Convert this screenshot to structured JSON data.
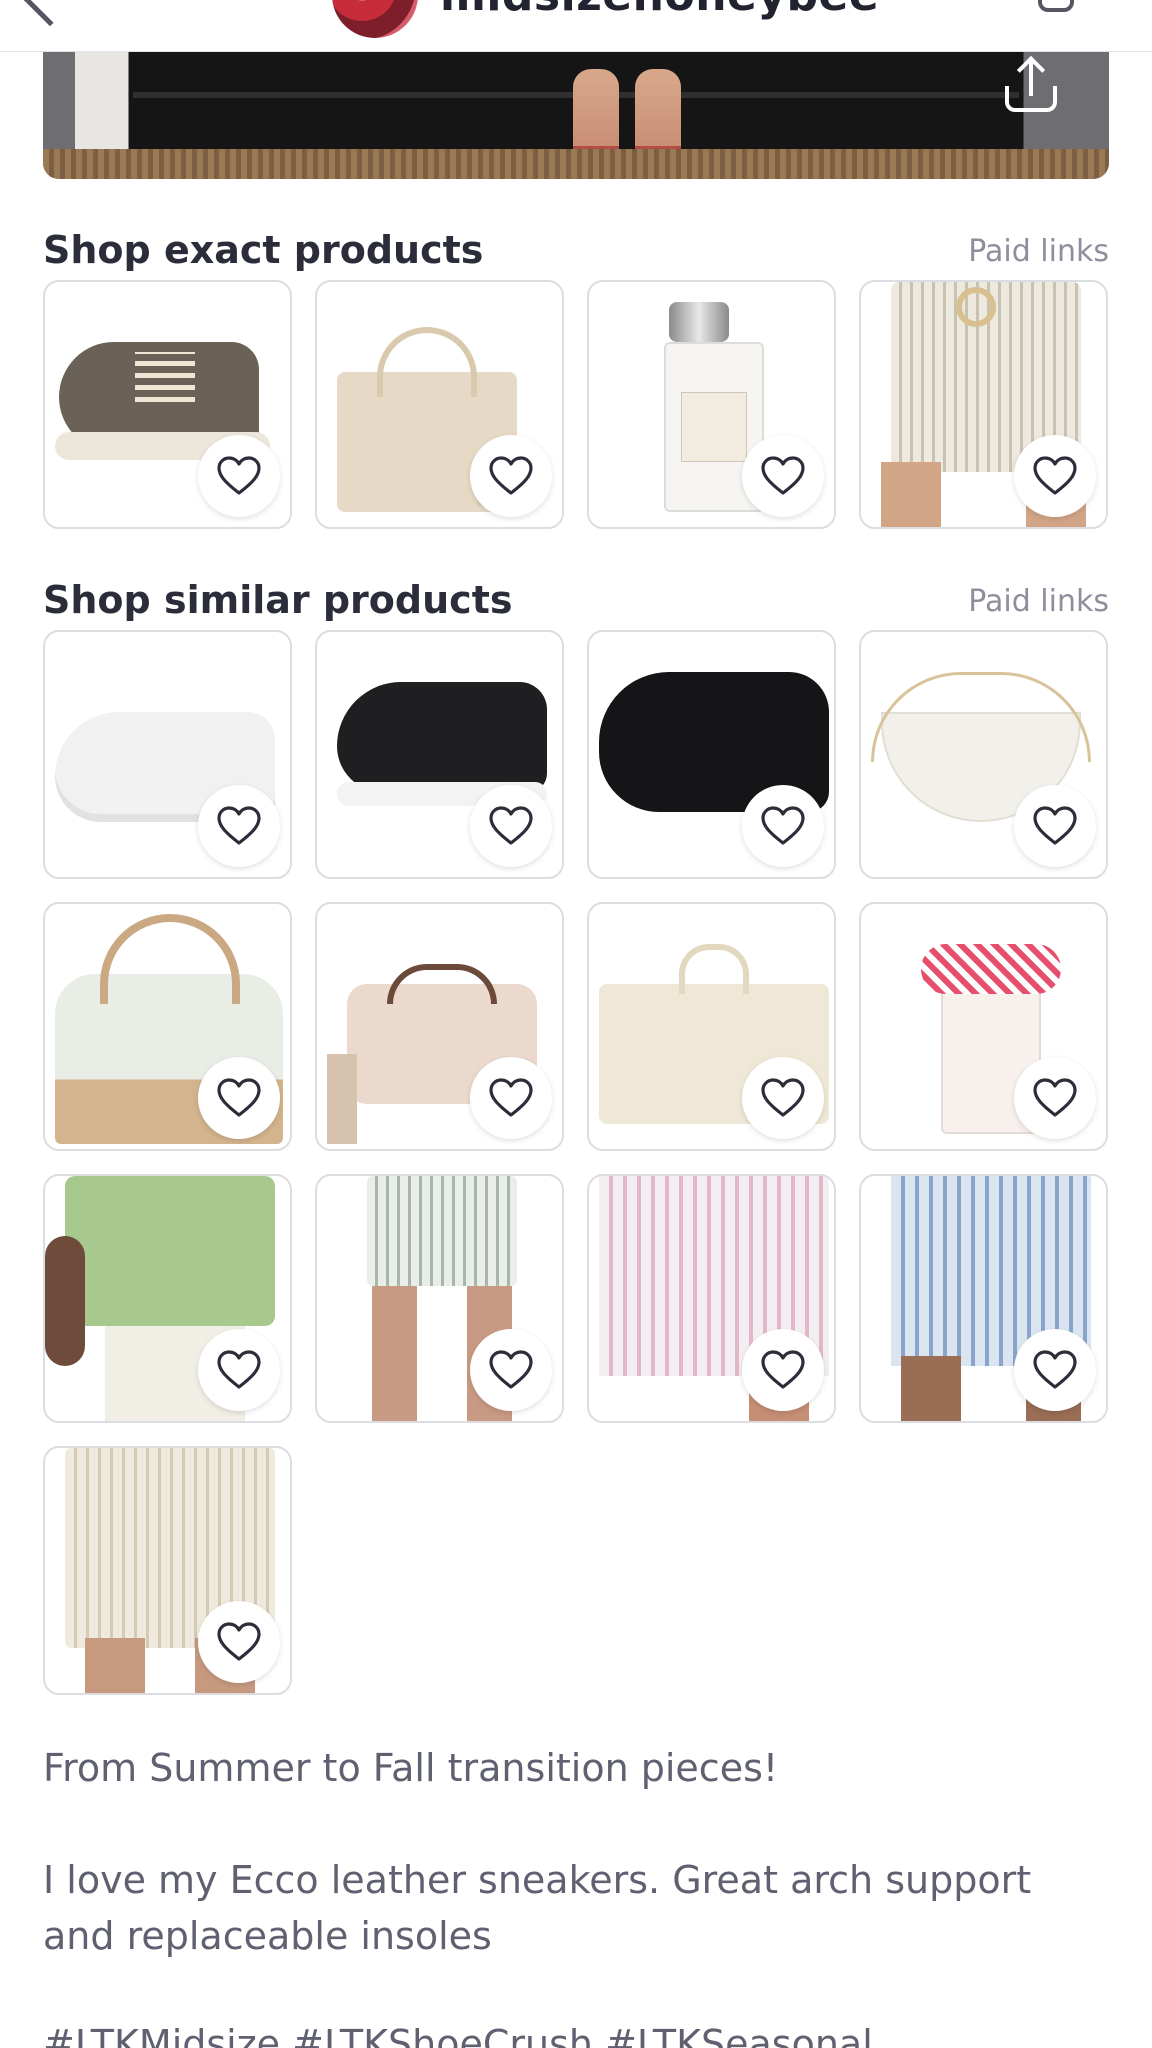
{
  "header": {
    "username": "midsizehoneybee"
  },
  "sections": {
    "exact": {
      "title": "Shop exact products",
      "paid_links": "Paid links",
      "products": [
        {
          "icon": "gray-sneaker"
        },
        {
          "icon": "beige-tote-bag"
        },
        {
          "icon": "perfume-bottle"
        },
        {
          "icon": "striped-shorts"
        }
      ]
    },
    "similar": {
      "title": "Shop similar products",
      "paid_links": "Paid links",
      "products": [
        {
          "icon": "white-sneaker"
        },
        {
          "icon": "black-sneaker"
        },
        {
          "icon": "black-sneaker-2"
        },
        {
          "icon": "white-shoulder-bag"
        },
        {
          "icon": "two-tone-satchel"
        },
        {
          "icon": "blush-camera-bag"
        },
        {
          "icon": "cream-crossbody-bag"
        },
        {
          "icon": "perfume-bottle-bow"
        },
        {
          "icon": "green-tee"
        },
        {
          "icon": "striped-shorts-2"
        },
        {
          "icon": "pink-striped-shorts"
        },
        {
          "icon": "blue-striped-shorts"
        },
        {
          "icon": "linen-shorts"
        }
      ]
    }
  },
  "caption": {
    "line1": "From Summer to Fall transition pieces!",
    "line2": "I love my Ecco leather sneakers. Great arch support and replaceable insoles",
    "hashtags": "#LTKMidsize #LTKShoeCrush #LTKSeasonal"
  },
  "colors": {
    "text_primary": "#2c2d3a",
    "text_secondary": "#5f6070",
    "paid_links": "#8e8f9c",
    "card_border": "#dcdce3"
  }
}
